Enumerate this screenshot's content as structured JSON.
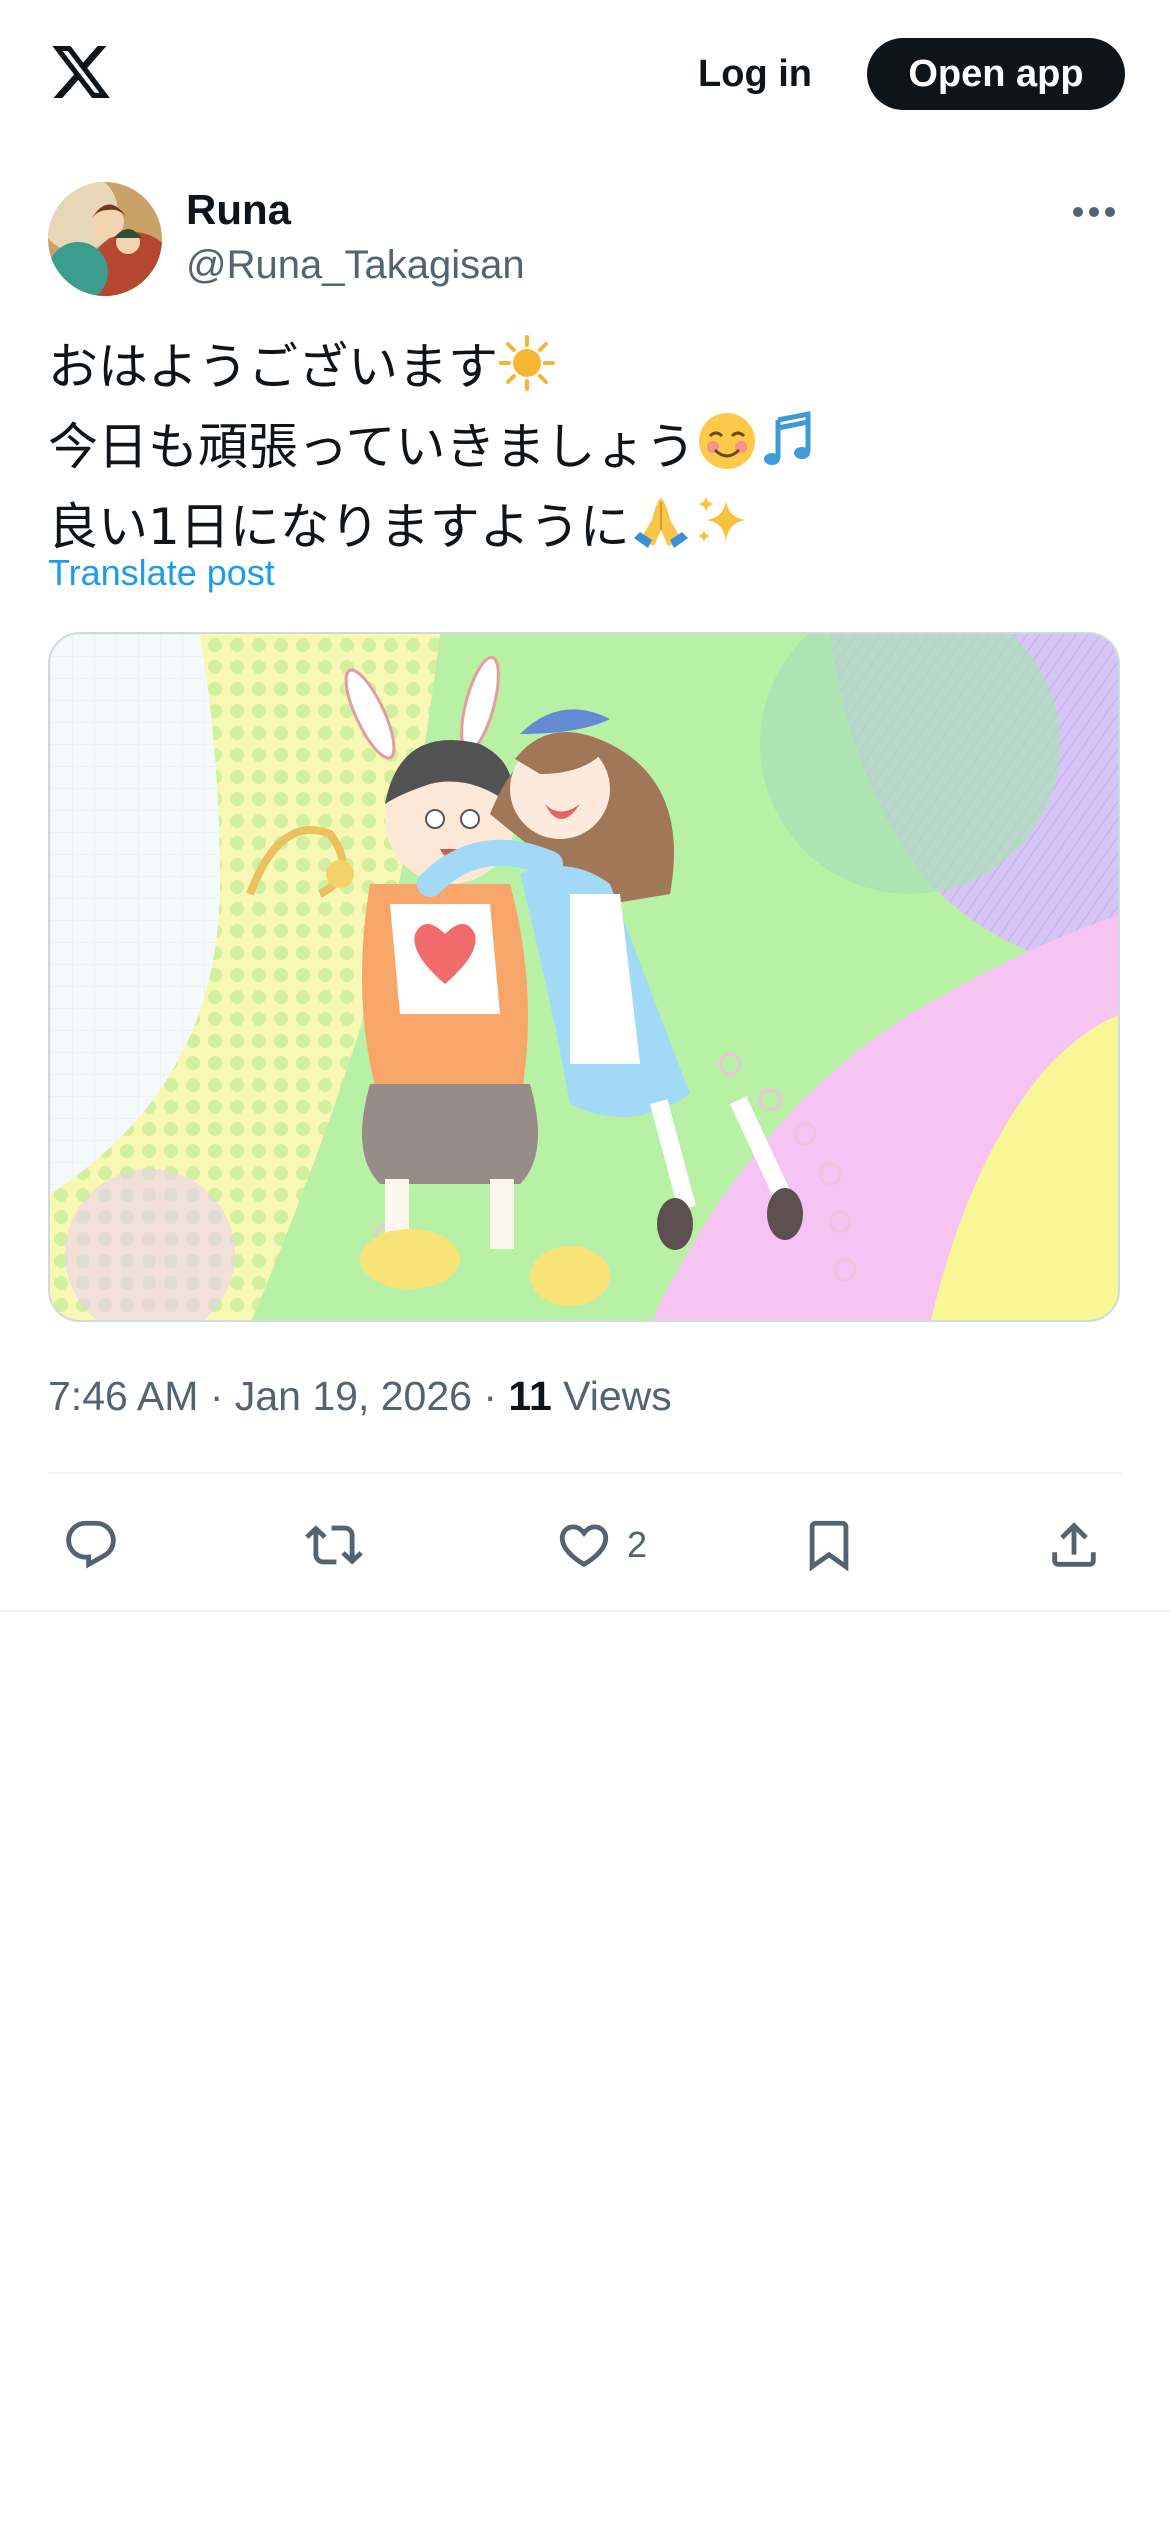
{
  "header": {
    "logo_icon": "x-logo-icon",
    "login_label": "Log in",
    "open_app_label": "Open app"
  },
  "post": {
    "author": {
      "display_name": "Runa",
      "handle": "@Runa_Takagisan",
      "avatar_icon": "avatar-image"
    },
    "more_icon": "more-horizontal-icon",
    "lines": [
      {
        "text": "おはようございます",
        "emoji": [
          "sun-emoji"
        ]
      },
      {
        "text": "今日も頑張っていきましょう",
        "emoji": [
          "smiling-face-emoji",
          "music-notes-emoji"
        ]
      },
      {
        "text": "良い1日になりますように",
        "emoji": [
          "folded-hands-emoji",
          "sparkles-emoji"
        ]
      }
    ],
    "translate_label": "Translate post",
    "media": {
      "description_icon": "anime-illustration-image"
    },
    "meta": {
      "time": "7:46 AM",
      "separator": " · ",
      "date": "Jan 19, 2026",
      "views_count": "11",
      "views_label": "Views"
    },
    "actions": {
      "reply_icon": "reply-icon",
      "repost_icon": "repost-icon",
      "like_icon": "heart-icon",
      "like_count": "2",
      "bookmark_icon": "bookmark-icon",
      "share_icon": "share-icon"
    }
  },
  "colors": {
    "text_primary": "#0f1419",
    "text_secondary": "#536471",
    "link": "#1d9bf0",
    "button_dark": "#0f1419",
    "divider": "#eff3f4"
  }
}
